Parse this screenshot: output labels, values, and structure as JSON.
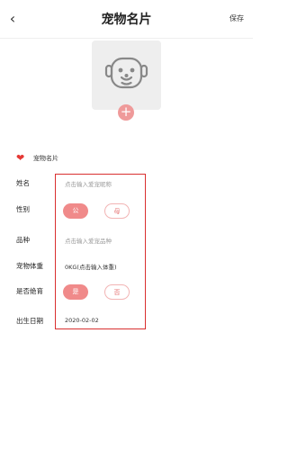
{
  "header": {
    "back_icon": "back-arrow-icon",
    "title": "宠物名片",
    "save_label": "保存"
  },
  "avatar": {
    "icon": "dog-face-icon",
    "add_icon": "plus-icon",
    "add_symbol": "+"
  },
  "section": {
    "icon": "heart-icon",
    "label": "宠物名片",
    "accent_color": "#e53935"
  },
  "form": {
    "name": {
      "label": "姓名",
      "placeholder": "点击输入爱宠昵称"
    },
    "gender": {
      "label": "性别",
      "options": [
        "公",
        "母"
      ],
      "selected": "公"
    },
    "breed": {
      "label": "品种",
      "placeholder": "点击输入爱宠品种"
    },
    "weight": {
      "label": "宠物体重",
      "value": "0KG(点击输入体重)"
    },
    "neutered": {
      "label": "是否绝育",
      "options": [
        "是",
        "否"
      ],
      "selected": "是"
    },
    "birthday": {
      "label": "出生日期",
      "value": "2020-02-02"
    }
  },
  "colors": {
    "pill_active": "#f08a8a",
    "highlight_border": "#d93030"
  }
}
